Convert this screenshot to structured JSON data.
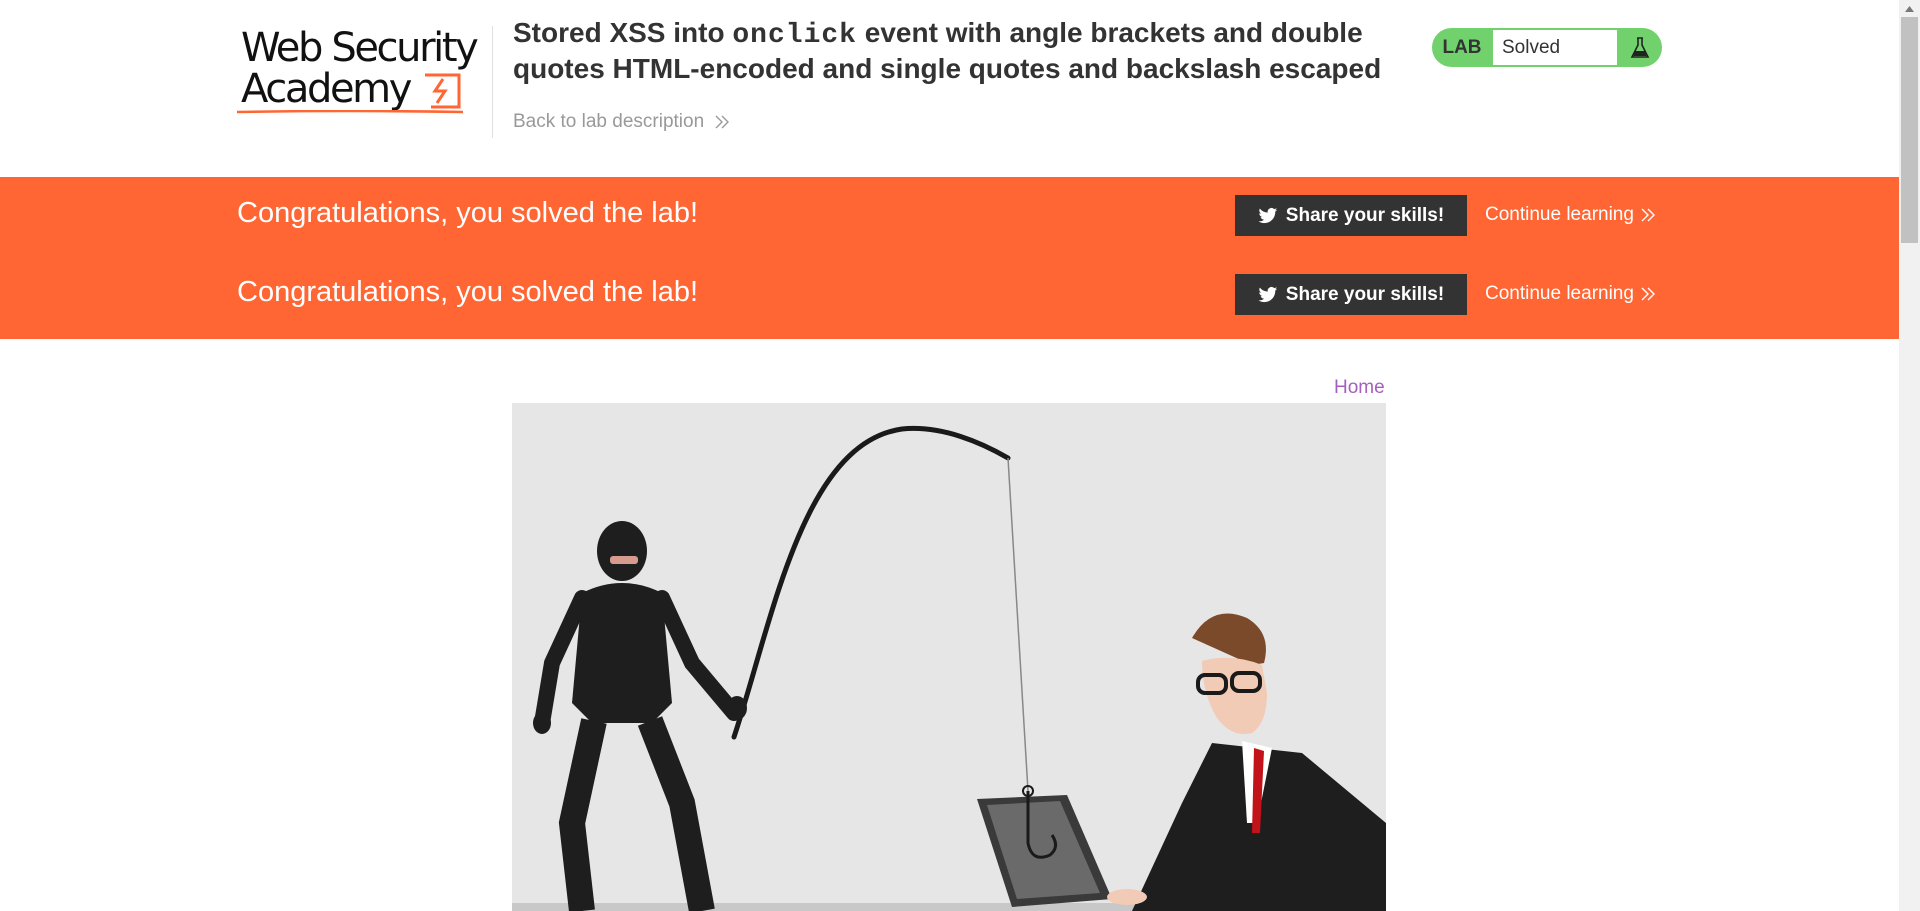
{
  "header": {
    "logo_line1": "Web Security",
    "logo_line2": "Academy",
    "title_prefix": "Stored XSS into ",
    "title_code": "onclick",
    "title_suffix": " event with angle brackets and double quotes HTML-encoded and single quotes and backslash escaped",
    "back_link": "Back to lab description",
    "status_label": "LAB",
    "status_value": "Solved"
  },
  "banner": {
    "rows": [
      {
        "message": "Congratulations, you solved the lab!",
        "share_label": "Share your skills!",
        "continue_label": "Continue learning"
      },
      {
        "message": "Congratulations, you solved the lab!",
        "share_label": "Share your skills!",
        "continue_label": "Continue learning"
      }
    ]
  },
  "nav": {
    "home_label": "Home"
  },
  "icons": {
    "logo": "web-security-academy-logo",
    "back": "double-chevron-right-icon",
    "flask": "flask-icon",
    "twitter": "twitter-icon",
    "continue": "double-chevron-right-icon"
  },
  "colors": {
    "banner": "#ff6633",
    "status_green": "#70d16d",
    "share_button": "#333333",
    "home_link": "#a55fbf",
    "logo_accent": "#ff6633"
  }
}
